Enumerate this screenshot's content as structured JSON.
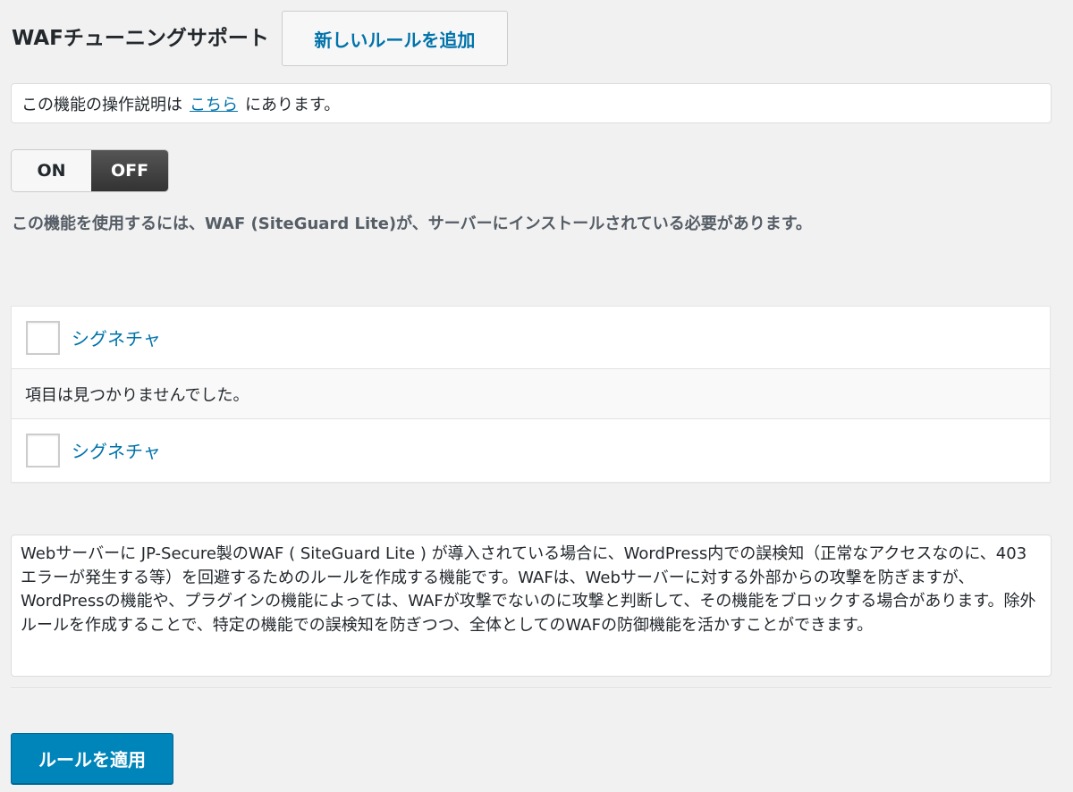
{
  "header": {
    "title": "WAFチューニングサポート",
    "add_button_label": "新しいルールを追加"
  },
  "notice": {
    "text_before": "この機能の操作説明は",
    "link_label": "こちら",
    "text_after": "にあります。"
  },
  "toggle": {
    "on_label": "ON",
    "off_label": "OFF",
    "selected": "OFF"
  },
  "requirement_note": "この機能を使用するには、WAF (SiteGuard Lite)が、サーバーにインストールされている必要があります。",
  "table": {
    "header_column_label": "シグネチャ",
    "empty_message": "項目は見つかりませんでした。",
    "footer_column_label": "シグネチャ"
  },
  "description": "Webサーバーに JP-Secure製のWAF ( SiteGuard Lite ) が導入されている場合に、WordPress内での誤検知（正常なアクセスなのに、403エラーが発生する等）を回避するためのルールを作成する機能です。WAFは、Webサーバーに対する外部からの攻撃を防ぎますが、WordPressの機能や、プラグインの機能によっては、WAFが攻撃でないのに攻撃と判断して、その機能をブロックする場合があります。除外ルールを作成することで、特定の機能での誤検知を防ぎつつ、全体としてのWAFの防御機能を活かすことができます。",
  "apply_button_label": "ルールを適用",
  "colors": {
    "link": "#0073aa",
    "primary_button": "#0085ba",
    "toggle_active": "#333333",
    "background": "#f1f1f1"
  }
}
